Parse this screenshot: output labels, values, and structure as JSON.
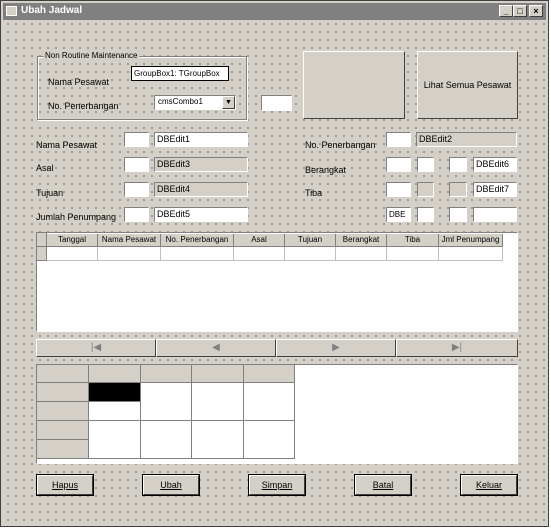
{
  "window": {
    "title": "Ubah Jadwal",
    "minimize": "_",
    "maximize": "□",
    "close": "×"
  },
  "group": {
    "caption": "Non Routine Maintenance",
    "nama_pesawat_label": "Nama Pesawat",
    "no_penerbangan_label": "No. Penerbangan",
    "groupbox_text": "GroupBox1: TGroupBox",
    "combo_value": "cmsCombo1"
  },
  "lihat_button": "Lihat Semua Pesawat",
  "form": {
    "nama_pesawat_label": "Nama Pesawat",
    "asal_label": "Asal",
    "tujuan_label": "Tujuan",
    "jumlah_label": "Jumlah Penumpang",
    "no_penerbangan_label": "No. Penerbangan",
    "berangkat_label": "Berangkat",
    "tiba_label": "Tiba",
    "dbedit1": "DBEdit1",
    "dbedit3": "DBEdit3",
    "dbedit4": "DBEdit4",
    "dbedit5": "DBEdit5",
    "dbedit2": "DBEdit2",
    "dbedit6": "DBEdit6",
    "dbedit7": "DBEdit7",
    "dbe": "DBE"
  },
  "grid": {
    "columns": [
      "Tanggal",
      "Nama Pesawat",
      "No. Penerbangan",
      "Asal",
      "Tujuan",
      "Berangkat",
      "Tiba",
      "Jml Penumpang"
    ]
  },
  "navigator": {
    "first": "|◀",
    "prior": "◀",
    "next": "▶",
    "last": "▶|"
  },
  "buttons": {
    "hapus": "Hapus",
    "ubah": "Ubah",
    "simpan": "Simpan",
    "batal": "Batal",
    "keluar": "Keluar"
  }
}
